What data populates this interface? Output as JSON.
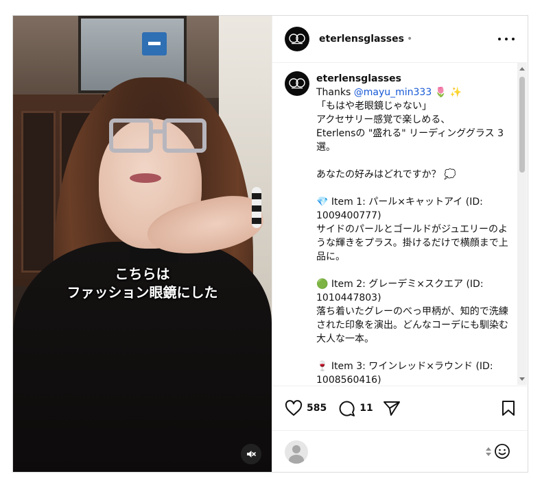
{
  "media": {
    "caption_line1": "こちらは",
    "caption_line2": "ファッション眼鏡にした",
    "mute_icon": "speaker-muted-icon"
  },
  "header": {
    "username": "eterlensglasses",
    "separator": "•",
    "more_icon": "more-options-icon"
  },
  "post_caption": {
    "username": "eterlensglasses",
    "thanks": "Thanks ",
    "mention": "@mayu_min333",
    "emoji": " 🌷 ✨",
    "body": "「もはや老眼鏡じゃない」\nアクセサリー感覚で楽しめる、\nEterlensの \"盛れる\" リーディンググラス 3選。\n\nあなたの好みはどれですか？ 💭\n\n💎 Item 1: パール×キャットアイ (ID: 1009400777)\nサイドのパールとゴールドがジュエリーのような輝きをプラス。掛けるだけで横顔まで上品に。\n\n🟢 Item 2: グレーデミ×スクエア (ID: 1010447803)\n落ち着いたグレーのべっ甲柄が、知的で洗練された印象を演出。どんなコーデにも馴染む大人な一本。\n\n🍷 Item 3: ワインレッド×ラウンド (ID: 1008560416)"
  },
  "actions": {
    "like_count": "585",
    "comment_count": "11",
    "like_icon": "heart-icon",
    "comment_icon": "comment-bubble-icon",
    "share_icon": "send-icon",
    "save_icon": "bookmark-icon"
  },
  "add_comment": {
    "avatar_icon": "user-avatar-icon",
    "emoji_icon": "smiley-icon"
  },
  "colors": {
    "border": "#dbdbdb",
    "mention_link": "#1558d6",
    "text": "#111111"
  }
}
